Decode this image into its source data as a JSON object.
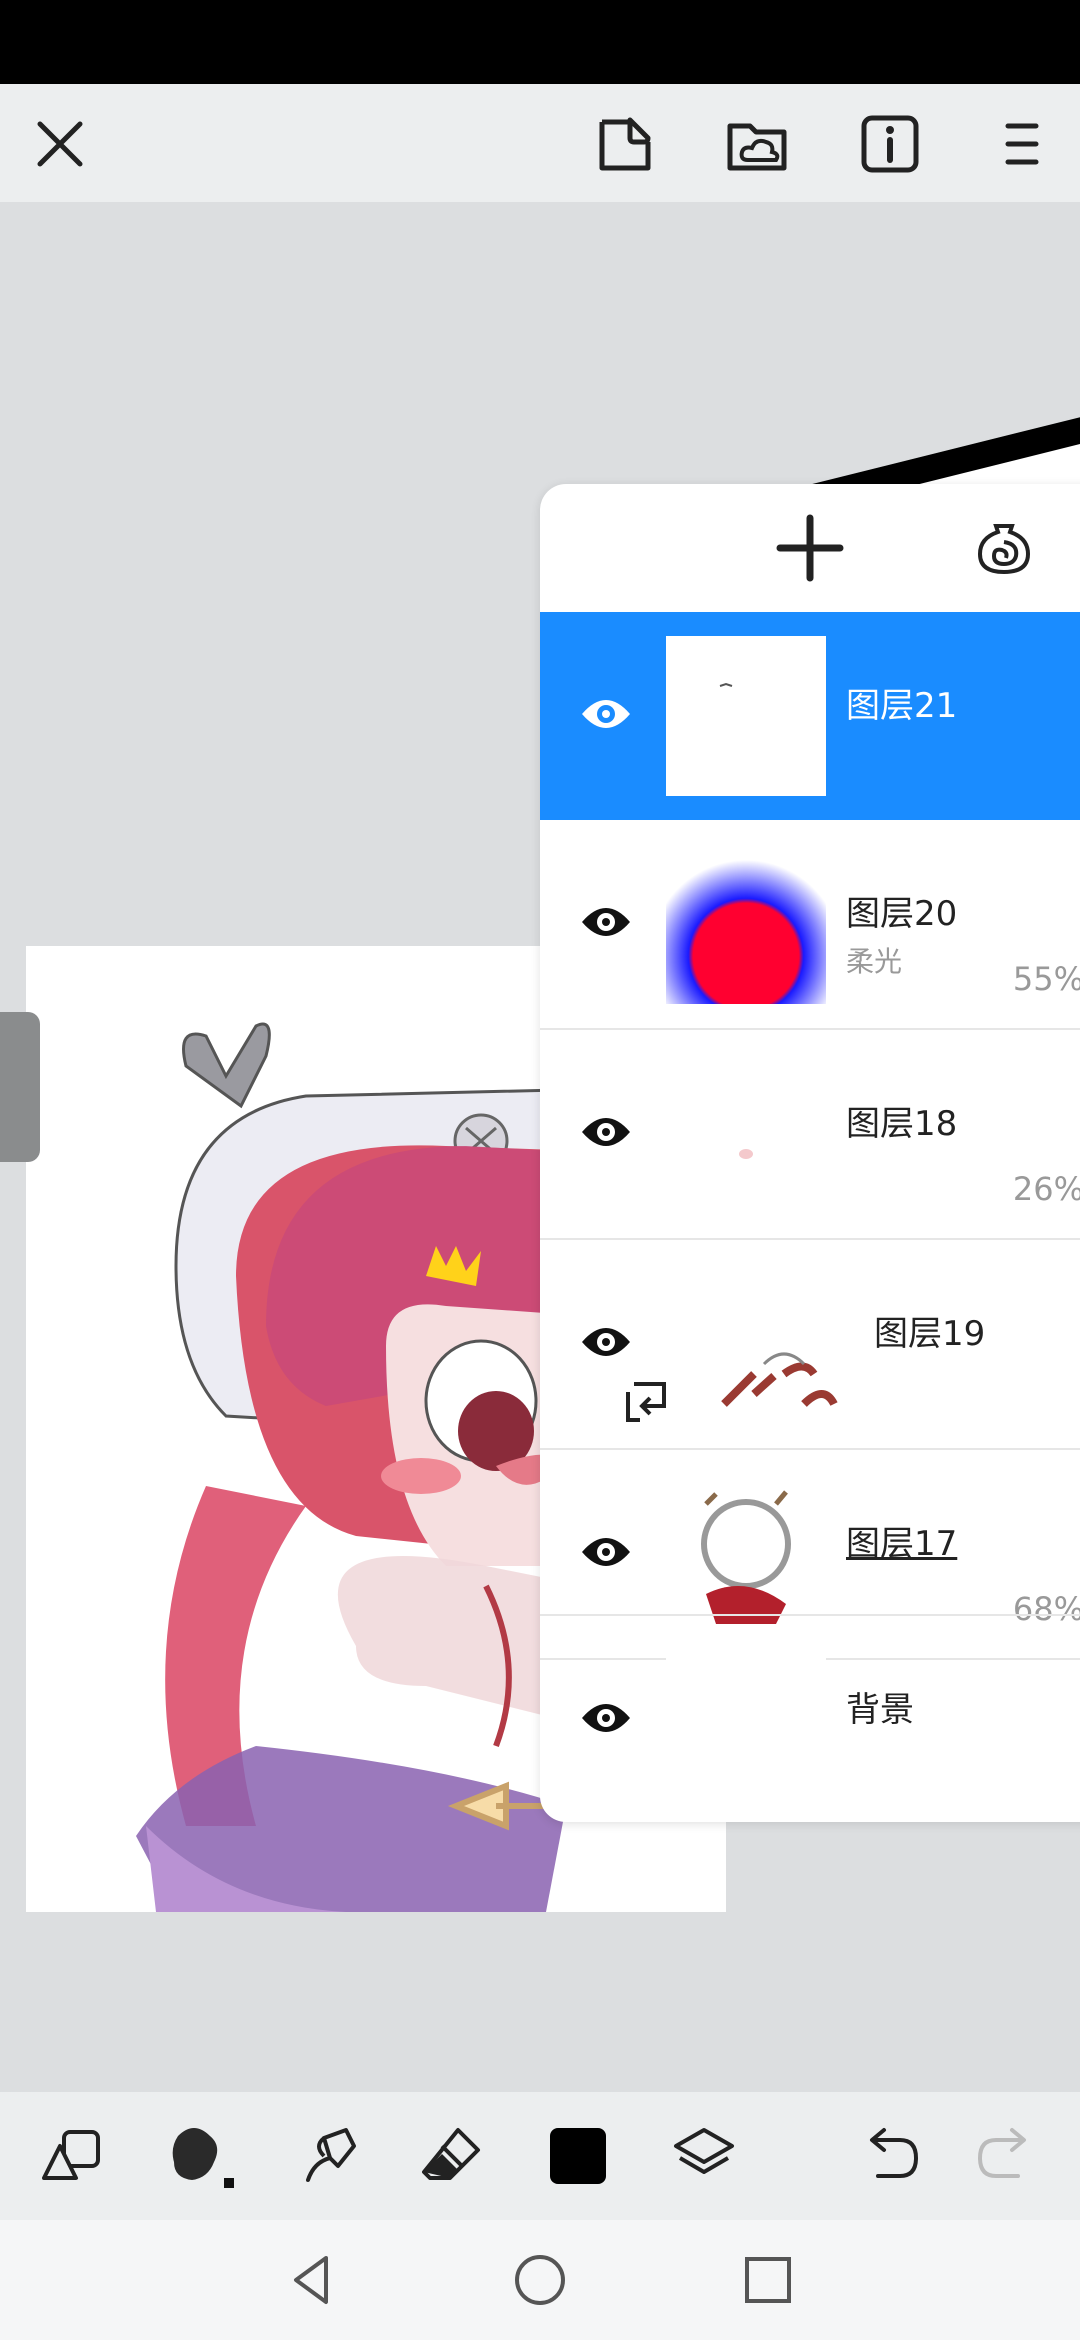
{
  "topbar": {
    "icons": [
      "close-icon",
      "sticker-icon",
      "cloud-folder-icon",
      "info-icon",
      "menu-icon"
    ]
  },
  "layers_panel": {
    "header_icons": [
      "add-layer-icon",
      "layer-effect-icon"
    ],
    "layers": [
      {
        "name": "图层21",
        "mode": "",
        "opacity": "",
        "selected": true,
        "clipped": false
      },
      {
        "name": "图层20",
        "mode": "柔光",
        "opacity": "55%",
        "selected": false,
        "clipped": false
      },
      {
        "name": "图层18",
        "mode": "",
        "opacity": "26%",
        "selected": false,
        "clipped": false
      },
      {
        "name": "图层19",
        "mode": "",
        "opacity": "",
        "selected": false,
        "clipped": true
      },
      {
        "name": "图层17",
        "mode": "",
        "opacity": "68%",
        "selected": false,
        "clipped": false
      },
      {
        "name": "背景",
        "mode": "",
        "opacity": "",
        "selected": false,
        "clipped": false
      }
    ]
  },
  "bottombar": {
    "icons": [
      "shapes-icon",
      "brush-icon",
      "smudge-icon",
      "eraser-icon",
      "color-swatch",
      "layers-icon",
      "undo-icon",
      "redo-icon"
    ],
    "color": "#000000"
  },
  "navbar": {
    "icons": [
      "back-icon",
      "home-icon",
      "recents-icon"
    ]
  }
}
